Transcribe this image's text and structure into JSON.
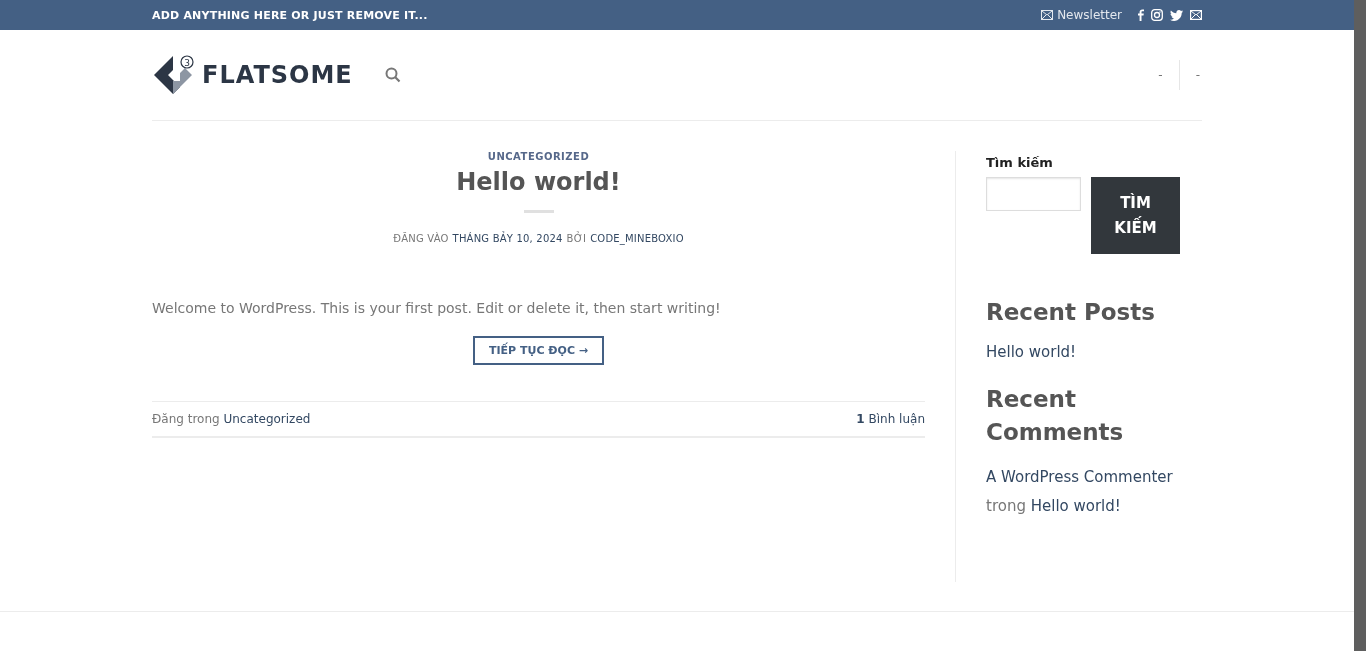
{
  "top_bar": {
    "text": "ADD ANYTHING HERE OR JUST REMOVE IT...",
    "newsletter": "Newsletter"
  },
  "header": {
    "logo": "FLATSOME",
    "logo_badge": "3",
    "nav": [
      "-",
      "-"
    ]
  },
  "post": {
    "category": "UNCATEGORIZED",
    "title": "Hello world!",
    "meta": {
      "prefix": "ĐĂNG VÀO",
      "date": "THÁNG BẢY 10, 2024",
      "by": "BỞI",
      "author": "CODE_MINEBOXIO"
    },
    "excerpt": "Welcome to WordPress. This is your first post. Edit or delete it, then start writing!",
    "read_more": "TIẾP TỤC ĐỌC →",
    "footer": {
      "posted_in": "Đăng trong",
      "category": "Uncategorized",
      "comment_count": "1",
      "comment_label": "Bình luận"
    }
  },
  "sidebar": {
    "search": {
      "title": "Tìm kiếm",
      "button": "TÌM KIẾM"
    },
    "recent_posts": {
      "title": "Recent Posts",
      "items": [
        "Hello world!"
      ]
    },
    "recent_comments": {
      "title": "Recent Comments",
      "items": [
        {
          "author": "A WordPress Commenter",
          "connector": "trong",
          "post": "Hello world!"
        }
      ]
    }
  }
}
